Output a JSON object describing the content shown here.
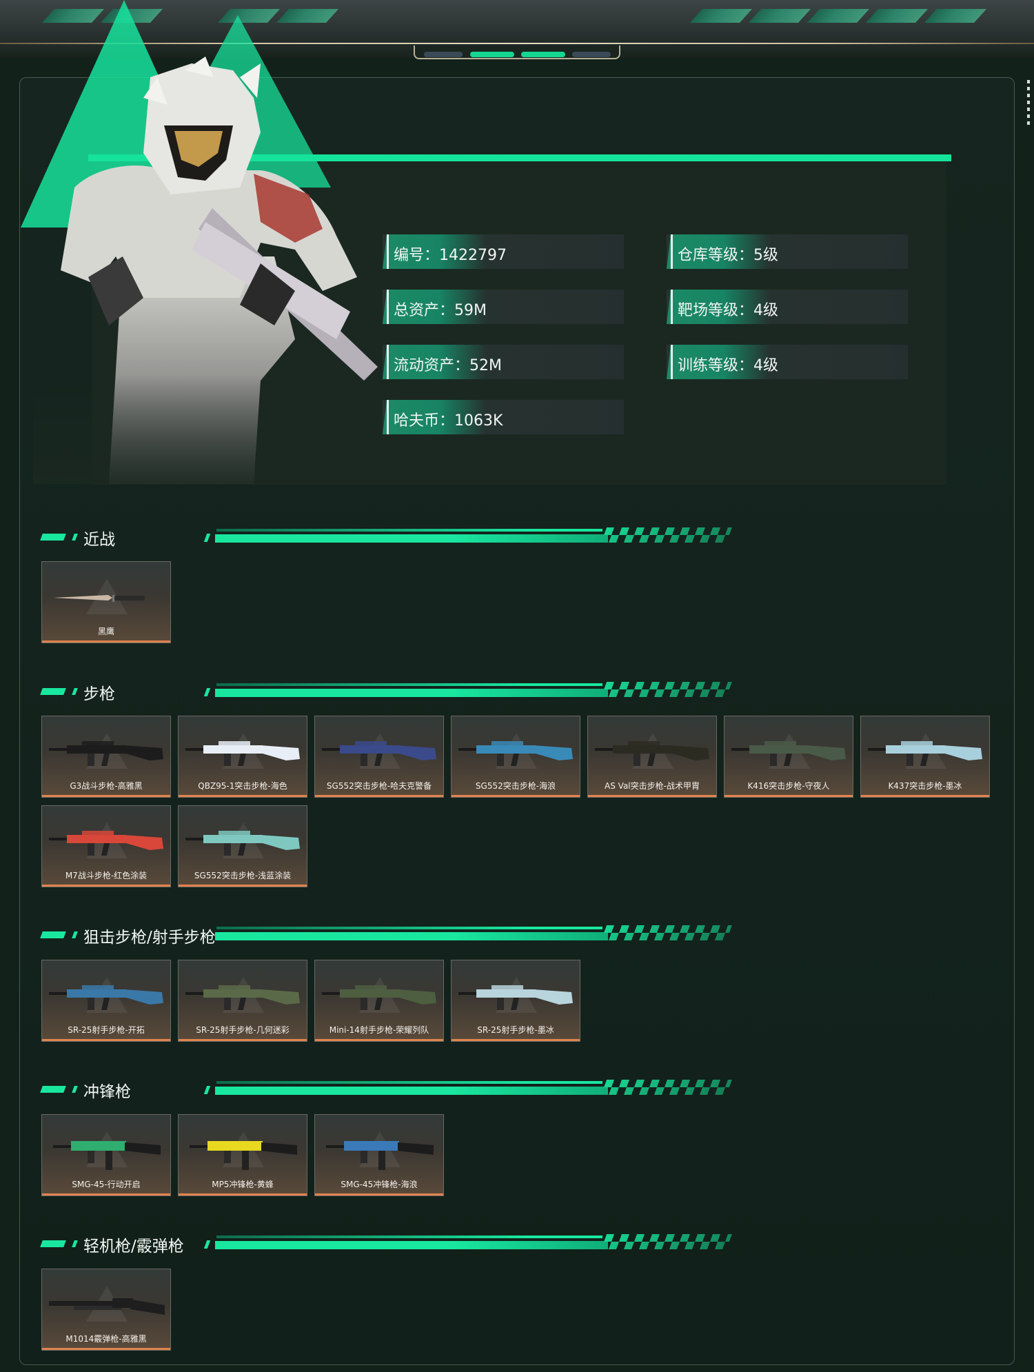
{
  "profile": {
    "id_text": "编号：1422797",
    "total_assets_text": "总资产：59M",
    "liquid_assets_text": "流动资产：52M",
    "coins_text": "哈夫币：1063K",
    "warehouse_level_text": "仓库等级：5级",
    "range_level_text": "靶场等级：4级",
    "training_level_text": "训练等级：4级"
  },
  "sections": {
    "melee": {
      "title": "近战",
      "items": [
        {
          "name": "黑鹰",
          "icon": "knife-icon",
          "color": "#c9b8a6"
        }
      ]
    },
    "rifle": {
      "title": "步枪",
      "items": [
        {
          "name": "G3战斗步枪-高雅黑",
          "icon": "rifle-icon",
          "color": "#1c1c1c"
        },
        {
          "name": "QBZ95-1突击步枪-海色",
          "icon": "rifle-icon",
          "color": "#e8eef6"
        },
        {
          "name": "SG552突击步枪-哈夫克警备",
          "icon": "rifle-icon",
          "color": "#3a4a8a"
        },
        {
          "name": "SG552突击步枪-海浪",
          "icon": "rifle-icon",
          "color": "#3a8ab8"
        },
        {
          "name": "AS Val突击步枪-战术甲胄",
          "icon": "rifle-icon",
          "color": "#2b2b22"
        },
        {
          "name": "K416突击步枪-守夜人",
          "icon": "rifle-icon",
          "color": "#4a5a48"
        },
        {
          "name": "K437突击步枪-墨冰",
          "icon": "rifle-icon",
          "color": "#a8d0dc"
        },
        {
          "name": "M7战斗步枪-红色涂装",
          "icon": "rifle-icon",
          "color": "#d9473a"
        },
        {
          "name": "SG552突击步枪-浅蓝涂装",
          "icon": "rifle-icon",
          "color": "#7ec8c0"
        }
      ]
    },
    "sniper": {
      "title": "狙击步枪/射手步枪",
      "items": [
        {
          "name": "SR-25射手步枪-开拓",
          "icon": "rifle-icon",
          "color": "#3a78a8"
        },
        {
          "name": "SR-25射手步枪-几何迷彩",
          "icon": "rifle-icon",
          "color": "#5a6a48"
        },
        {
          "name": "Mini-14射手步枪-荣耀列队",
          "icon": "rifle-icon",
          "color": "#4e5e40"
        },
        {
          "name": "SR-25射手步枪-墨冰",
          "icon": "rifle-icon",
          "color": "#b8d4dc"
        }
      ]
    },
    "smg": {
      "title": "冲锋枪",
      "items": [
        {
          "name": "SMG-45-行动开启",
          "icon": "smg-icon",
          "color": "#2fae70"
        },
        {
          "name": "MP5冲锋枪-黄蜂",
          "icon": "smg-icon",
          "color": "#e8d820"
        },
        {
          "name": "SMG-45冲锋枪-海浪",
          "icon": "smg-icon",
          "color": "#3a7ab8"
        }
      ]
    },
    "lmg": {
      "title": "轻机枪/霰弹枪",
      "items": [
        {
          "name": "M1014霰弹枪-高雅黑",
          "icon": "shotgun-icon",
          "color": "#1e1e1e"
        }
      ]
    }
  },
  "theme": {
    "accent": "#16e39b",
    "card_underline": "#e0834f",
    "panel_bg": "#13211b"
  }
}
